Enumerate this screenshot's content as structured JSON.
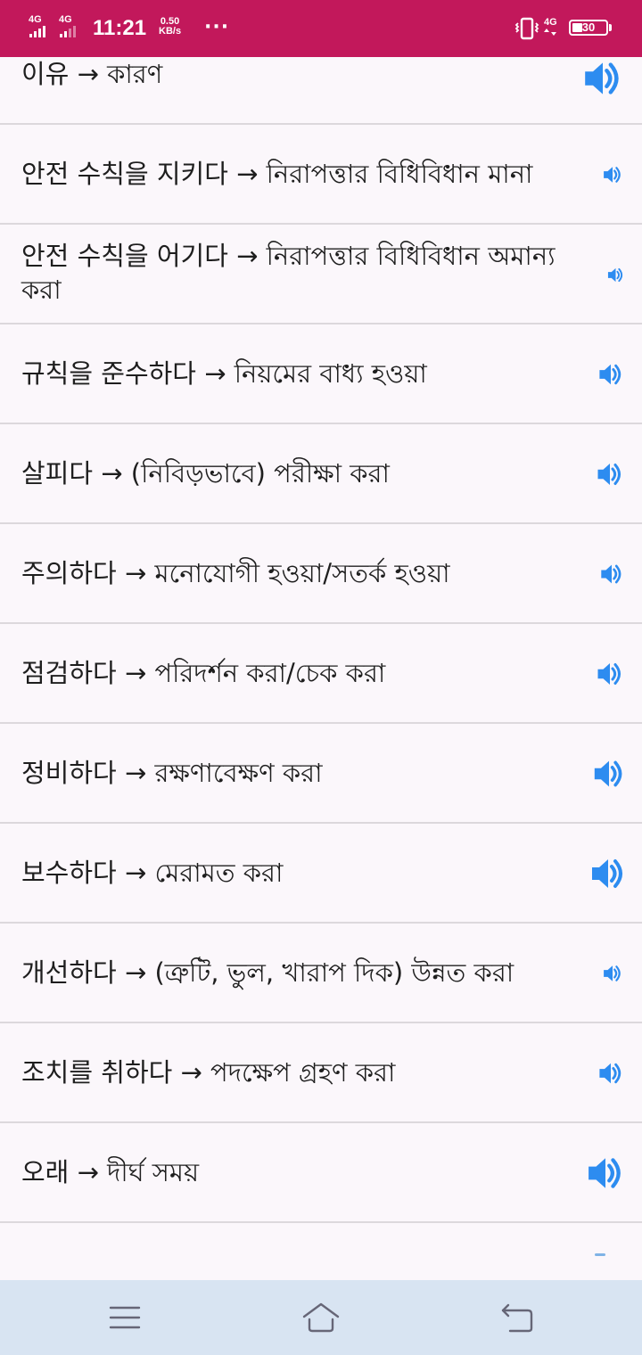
{
  "status_bar": {
    "network_1": "4G",
    "network_2": "4G",
    "time": "11:21",
    "speed_value": "0.50",
    "speed_unit": "KB/s",
    "more": "···",
    "network_3": "4G",
    "battery_percent": "30",
    "icons": [
      "signal-icon",
      "signal-icon",
      "vibrate-icon",
      "battery-icon"
    ],
    "background_color": "#c2185b"
  },
  "list": {
    "speaker_color": "#2d8cf0",
    "items": [
      {
        "text": "이유 → কারণ",
        "icon": "speaker-icon"
      },
      {
        "text": "안전 수칙을 지키다 → নিরাপত্তার বিধিবিধান মানা",
        "icon": "speaker-icon"
      },
      {
        "text": "안전 수칙을 어기다 → নিরাপত্তার বিধিবিধান অমান্য করা",
        "icon": "speaker-icon"
      },
      {
        "text": "규칙을 준수하다 → নিয়মের বাধ্য হওয়া",
        "icon": "speaker-icon"
      },
      {
        "text": "살피다 → (নিবিড়ভাবে) পরীক্ষা করা",
        "icon": "speaker-icon"
      },
      {
        "text": "주의하다 → মনোযোগী হওয়া/সতর্ক হওয়া",
        "icon": "speaker-icon"
      },
      {
        "text": "점검하다 → পরিদর্শন করা/চেক করা",
        "icon": "speaker-icon"
      },
      {
        "text": "정비하다 → রক্ষণাবেক্ষণ করা",
        "icon": "speaker-icon"
      },
      {
        "text": "보수하다 → মেরামত করা",
        "icon": "speaker-icon"
      },
      {
        "text": "개선하다 → (ত্রুটি, ভুল, খারাপ দিক) উন্নত করা",
        "icon": "speaker-icon"
      },
      {
        "text": "조치를 취하다 → পদক্ষেপ গ্রহণ করা",
        "icon": "speaker-icon"
      },
      {
        "text": "오래 → দীর্ঘ সময়",
        "icon": "speaker-icon"
      }
    ]
  },
  "nav_bar": {
    "buttons": [
      "menu-icon",
      "home-icon",
      "back-icon"
    ],
    "background_color": "#d8e4f2"
  }
}
